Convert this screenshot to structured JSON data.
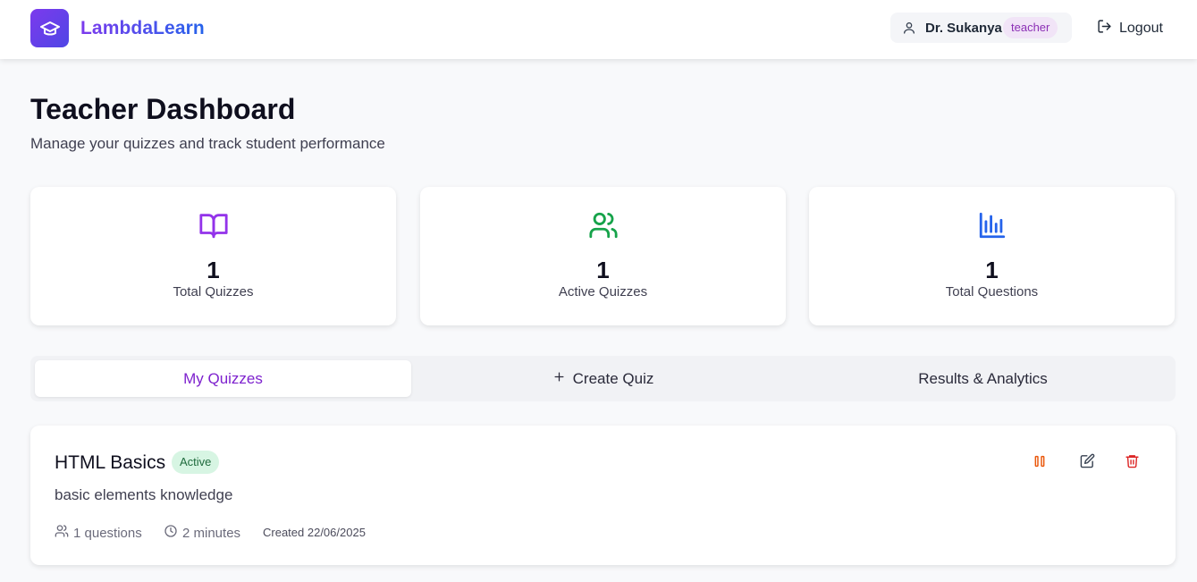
{
  "app": {
    "brand": "LambdaLearn",
    "logo_icon": "graduation-cap-icon"
  },
  "header": {
    "user_name": "Dr. Sukanya",
    "user_role": "teacher",
    "logout_label": "Logout"
  },
  "page": {
    "title": "Teacher Dashboard",
    "subtitle": "Manage your quizzes and track student performance"
  },
  "stats": [
    {
      "icon": "book-open-icon",
      "value": "1",
      "label": "Total Quizzes",
      "color": "#9333ea"
    },
    {
      "icon": "users-icon",
      "value": "1",
      "label": "Active Quizzes",
      "color": "#16a34a"
    },
    {
      "icon": "bar-chart-icon",
      "value": "1",
      "label": "Total Questions",
      "color": "#2563eb"
    }
  ],
  "tabs": [
    {
      "label": "My Quizzes",
      "active": true
    },
    {
      "label": "Create Quiz",
      "icon": "plus-icon"
    },
    {
      "label": "Results & Analytics"
    }
  ],
  "quizzes": [
    {
      "title": "HTML Basics",
      "status": "Active",
      "description": "basic elements knowledge",
      "questions": "1 questions",
      "duration": "2 minutes",
      "created": "Created 22/06/2025"
    }
  ],
  "colors": {
    "accent": "#7e22ce",
    "brand_gradient_start": "#7c3aed",
    "brand_gradient_end": "#2563eb",
    "pause": "#ea580c",
    "delete": "#dc2626"
  }
}
